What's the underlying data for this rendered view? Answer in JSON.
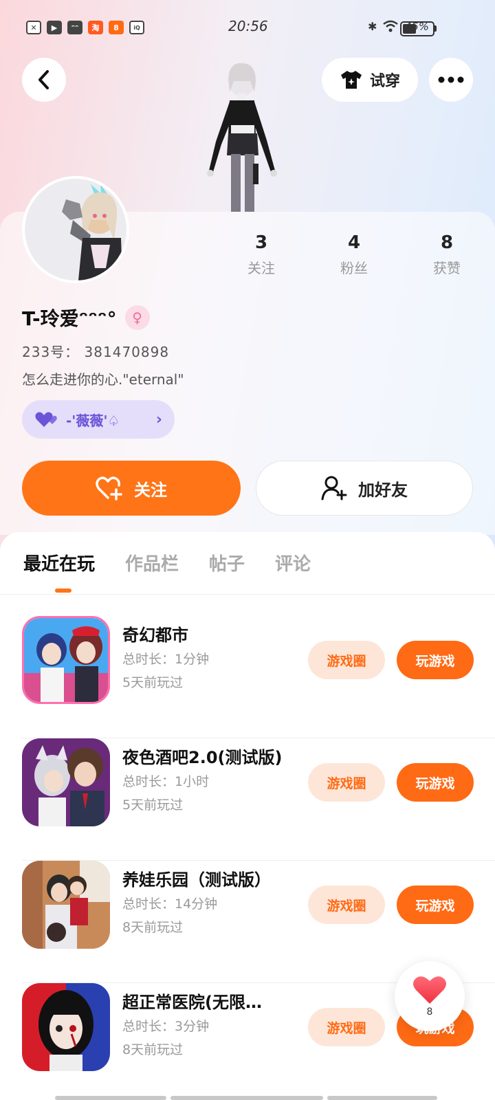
{
  "status_bar": {
    "time": "20:56",
    "battery_text": "45%",
    "battery_level": 0.45
  },
  "header": {
    "tryon_label": "试穿"
  },
  "profile": {
    "username": "T-玲爱ᵔᵔᵔ°",
    "gender": "female",
    "uid_label": "233号：",
    "uid_value": "381470898",
    "bio": "怎么走进你的心.\"eternal\"",
    "club_name": "-'薇薇'♤",
    "stats": [
      {
        "value": "3",
        "label": "关注"
      },
      {
        "value": "4",
        "label": "粉丝"
      },
      {
        "value": "8",
        "label": "获赞"
      }
    ]
  },
  "actions": {
    "follow_label": "关注",
    "add_friend_label": "加好友"
  },
  "tabs": [
    {
      "label": "最近在玩",
      "active": true
    },
    {
      "label": "作品栏",
      "active": false
    },
    {
      "label": "帖子",
      "active": false
    },
    {
      "label": "评论",
      "active": false
    }
  ],
  "games": [
    {
      "title": "奇幻都市",
      "duration": "总时长：1分钟",
      "last_played": "5天前玩过",
      "circle_label": "游戏圈",
      "play_label": "玩游戏"
    },
    {
      "title": "夜色酒吧2.0(测试版)",
      "duration": "总时长：1小时",
      "last_played": "5天前玩过",
      "circle_label": "游戏圈",
      "play_label": "玩游戏"
    },
    {
      "title": "养娃乐园（测试版）",
      "duration": "总时长：14分钟",
      "last_played": "8天前玩过",
      "circle_label": "游戏圈",
      "play_label": "玩游戏"
    },
    {
      "title": "超正常医院(无限…",
      "duration": "总时长：3分钟",
      "last_played": "8天前玩过",
      "circle_label": "游戏圈",
      "play_label": "玩游戏"
    }
  ],
  "like_float": {
    "count": "8"
  },
  "colors": {
    "accent": "#ff7417",
    "accent_light": "#fde6d8",
    "club_bg": "#e5defa",
    "club_text": "#6a55d8"
  }
}
